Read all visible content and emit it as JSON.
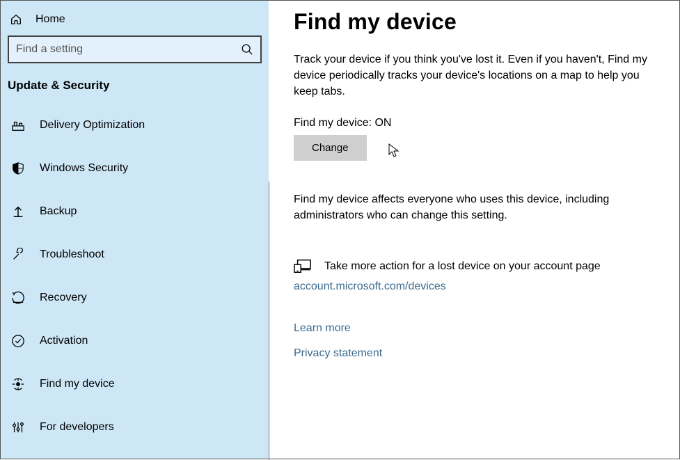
{
  "sidebar": {
    "home_label": "Home",
    "search_placeholder": "Find a setting",
    "section_title": "Update & Security",
    "items": [
      {
        "label": "Delivery Optimization"
      },
      {
        "label": "Windows Security"
      },
      {
        "label": "Backup"
      },
      {
        "label": "Troubleshoot"
      },
      {
        "label": "Recovery"
      },
      {
        "label": "Activation"
      },
      {
        "label": "Find my device"
      },
      {
        "label": "For developers"
      }
    ]
  },
  "main": {
    "title": "Find my device",
    "intro": "Track your device if you think you've lost it. Even if you haven't, Find my device periodically tracks your device's locations on a map to help you keep tabs.",
    "status_label": "Find my device: ON",
    "change_button": "Change",
    "note": "Find my device affects everyone who uses this device, including administrators who can change this setting.",
    "action_text": "Take more action for a lost device on your account page",
    "account_link": "account.microsoft.com/devices",
    "learn_more": "Learn more",
    "privacy": "Privacy statement"
  }
}
